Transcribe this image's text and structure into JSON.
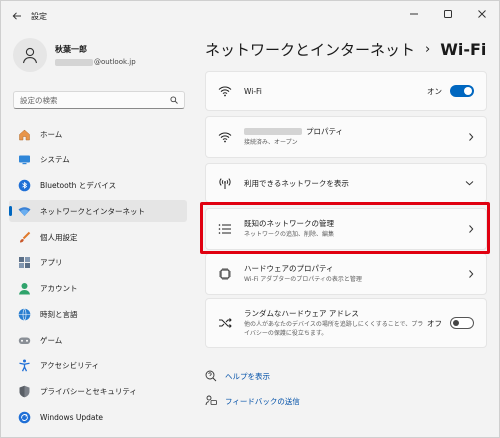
{
  "window": {
    "title": "設定"
  },
  "profile": {
    "name": "秋葉一郎",
    "email_suffix": "@outlook.jp"
  },
  "search": {
    "placeholder": "設定の検索"
  },
  "sidebar": {
    "items": [
      {
        "label": "ホーム",
        "icon": "home-icon"
      },
      {
        "label": "システム",
        "icon": "system-icon"
      },
      {
        "label": "Bluetooth とデバイス",
        "icon": "bluetooth-icon"
      },
      {
        "label": "ネットワークとインターネット",
        "icon": "network-icon",
        "active": true
      },
      {
        "label": "個人用設定",
        "icon": "brush-icon"
      },
      {
        "label": "アプリ",
        "icon": "apps-icon"
      },
      {
        "label": "アカウント",
        "icon": "account-icon"
      },
      {
        "label": "時刻と言語",
        "icon": "time-language-icon"
      },
      {
        "label": "ゲーム",
        "icon": "gaming-icon"
      },
      {
        "label": "アクセシビリティ",
        "icon": "accessibility-icon"
      },
      {
        "label": "プライバシーとセキュリティ",
        "icon": "shield-icon"
      },
      {
        "label": "Windows Update",
        "icon": "windows-update-icon"
      }
    ]
  },
  "header": {
    "crumb": "ネットワークとインターネット",
    "separator": "›",
    "current": "Wi-Fi"
  },
  "cards": {
    "wifi": {
      "title": "Wi-Fi",
      "toggle_label": "オン"
    },
    "props": {
      "title_suffix": "プロパティ",
      "subtitle": "接続済み、オープン"
    },
    "available": {
      "title": "利用できるネットワークを表示"
    },
    "known": {
      "title": "既知のネットワークの管理",
      "subtitle": "ネットワークの追加、削除、編集"
    },
    "hardware": {
      "title": "ハードウェアのプロパティ",
      "subtitle": "Wi-Fi アダプターのプロパティの表示と管理"
    },
    "random": {
      "title": "ランダムなハードウェア アドレス",
      "subtitle": "他の人があなたのデバイスの場所を追跡しにくくすることで、プライバシーの保護に役立ちます。",
      "toggle_label": "オフ"
    }
  },
  "links": {
    "help": "ヘルプを表示",
    "feedback": "フィードバックの送信"
  },
  "colors": {
    "accent": "#0067c0",
    "highlight": "#e00010"
  }
}
